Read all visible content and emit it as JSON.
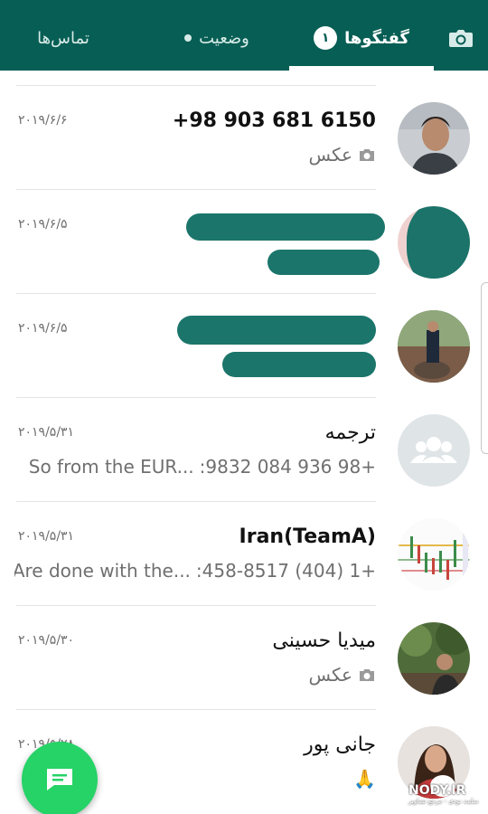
{
  "tabs": {
    "contacts": "تماس‌ها",
    "status": "وضعیت",
    "chats": "گفتگوها",
    "chats_badge": "۱"
  },
  "chats": [
    {
      "name": "+98 903 681 6150",
      "time": "۲۰۱۹/۶/۶",
      "preview_prefix": "",
      "preview": "عکس",
      "preview_icon": "camera-icon",
      "avatar": "photo-young-man"
    },
    {
      "name": "",
      "time": "۲۰۱۹/۶/۵",
      "preview_prefix": "",
      "preview": "",
      "preview_icon": "",
      "avatar": "redacted"
    },
    {
      "name": "",
      "time": "۲۰۱۹/۶/۵",
      "preview_prefix": "",
      "preview": "",
      "preview_icon": "",
      "avatar": "photo-man-outdoor"
    },
    {
      "name": "ترجمه",
      "time": "۲۰۱۹/۵/۳۱",
      "preview_prefix": "+98 936 084 9832:",
      "preview": "So from the EUR...",
      "preview_icon": "",
      "avatar": "group-icon"
    },
    {
      "name": "Iran(TeamA)",
      "time": "۲۰۱۹/۵/۳۱",
      "preview_prefix": "+1 (404) 458-8517:",
      "preview": "Are done with the...",
      "preview_icon": "",
      "avatar": "chart-thumbnail"
    },
    {
      "name": "میدیا حسینی",
      "time": "۲۰۱۹/۵/۳۰",
      "preview_prefix": "",
      "preview": "عکس",
      "preview_icon": "camera-icon",
      "avatar": "photo-man-forest"
    },
    {
      "name": "جانی پور",
      "time": "۲۰۱۹/۵/۲۸",
      "preview_prefix": "",
      "preview": "🙏",
      "preview_icon": "",
      "avatar": "photo-woman-dog"
    }
  ],
  "watermark": {
    "main": "NODY.IR",
    "sub": "سایت نودی - مرجع تصاویر"
  },
  "colors": {
    "header": "#075e54",
    "fab": "#25d366",
    "accent": "#ffffff"
  }
}
